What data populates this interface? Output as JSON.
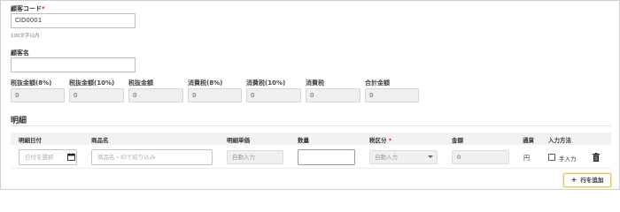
{
  "customer_code": {
    "label": "顧客コード",
    "required_mark": "*",
    "value": "CID0001",
    "hint": "100文字以内"
  },
  "customer_name": {
    "label": "顧客名",
    "value": ""
  },
  "summary": [
    {
      "label": "税抜金額(8%)",
      "value": "0"
    },
    {
      "label": "税抜金額(10%)",
      "value": "0"
    },
    {
      "label": "税抜金額",
      "value": "0"
    },
    {
      "label": "消費税(8%)",
      "value": "0"
    },
    {
      "label": "消費税(10%)",
      "value": "0"
    },
    {
      "label": "消費税",
      "value": "0"
    },
    {
      "label": "合計金額",
      "value": "0"
    }
  ],
  "details": {
    "title": "明細",
    "columns": {
      "date": "明細日付",
      "product": "商品名",
      "unit_price": "明細単価",
      "quantity": "数量",
      "tax_category": "税区分",
      "tax_required_mark": "*",
      "amount": "金額",
      "currency": "通貨",
      "input_method": "入力方法"
    },
    "row": {
      "date_placeholder": "日付を選択",
      "product_placeholder": "商品名・IDで絞り込み",
      "unit_price_value": "自動入力",
      "quantity_value": "",
      "tax_category_value": "自動入力",
      "amount_value": "0",
      "currency": "円",
      "manual_input_label": "手入力",
      "manual_input_checked": false
    },
    "add_row_label": "行を追加"
  },
  "colors": {
    "required": "#d9262c",
    "add_button_border": "#e8c85a",
    "header_bg": "#f2f2f2",
    "readonly_bg": "#efefef"
  },
  "icons": [
    "calendar-icon",
    "chevron-down-icon",
    "checkbox-icon",
    "trash-icon",
    "plus-icon"
  ]
}
